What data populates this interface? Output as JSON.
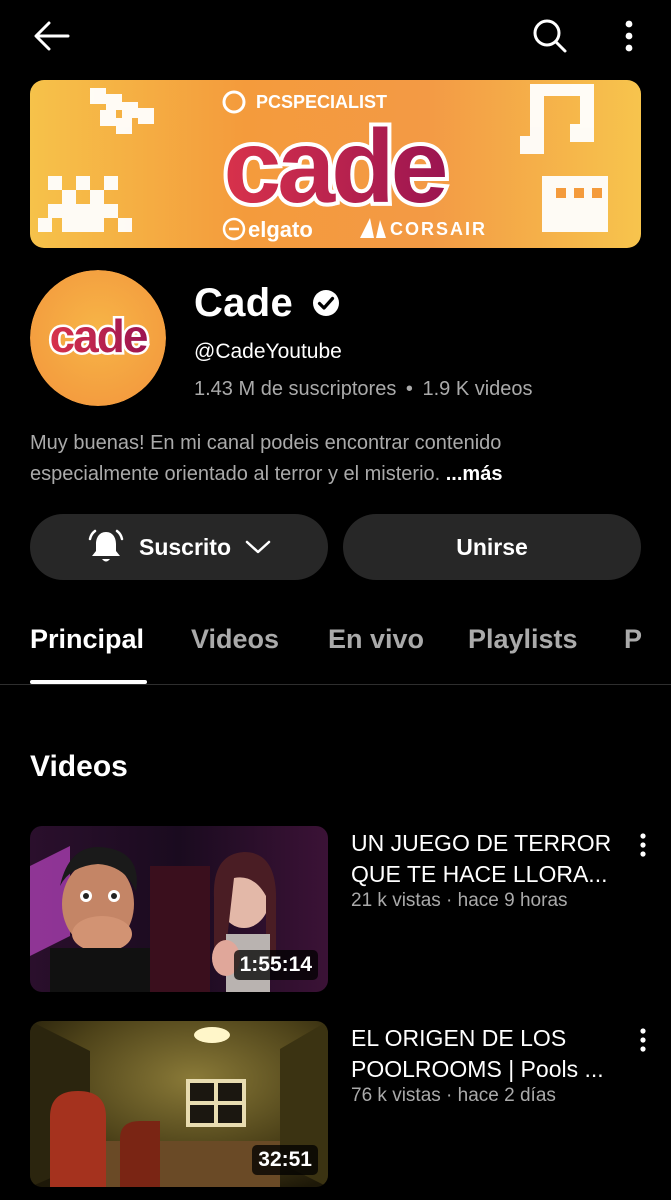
{
  "topbar": {
    "back_icon": "arrow-left-icon",
    "search_icon": "search-icon",
    "more_icon": "more-vert-icon"
  },
  "banner": {
    "brand_main": "cade",
    "sponsor_top": "PCSPECIALIST",
    "sponsor_left": "elgato",
    "sponsor_right": "CORSAIR"
  },
  "avatar": {
    "text": "cade"
  },
  "channel": {
    "name": "Cade",
    "verified_icon": "verified-check-icon",
    "handle": "@CadeYoutube",
    "subscribers": "1.43 M de suscriptores",
    "separator": "•",
    "videos_count": "1.9 K videos",
    "description_line1": "Muy buenas! En mi canal podeis encontrar contenido",
    "description_line2": "especialmente orientado al terror y el misterio.",
    "more_label": "...más"
  },
  "actions": {
    "subscribed_label": "Suscrito",
    "bell_icon": "bell-icon",
    "chevron_icon": "chevron-down-icon",
    "join_label": "Unirse"
  },
  "tabs": [
    {
      "label": "Principal",
      "active": true
    },
    {
      "label": "Videos",
      "active": false
    },
    {
      "label": "En vivo",
      "active": false
    },
    {
      "label": "Playlists",
      "active": false
    },
    {
      "label": "P",
      "active": false
    }
  ],
  "section": {
    "title": "Videos"
  },
  "videos": [
    {
      "title_line1": "UN JUEGO DE TERROR",
      "title_line2": "QUE TE HACE LLORA...",
      "views": "21 k vistas",
      "age": "hace 9 horas",
      "duration": "1:55:14"
    },
    {
      "title_line1": "EL ORIGEN DE LOS",
      "title_line2": "POOLROOMS | Pools ...",
      "views": "76 k vistas",
      "age": "hace 2 días",
      "duration": "32:51"
    }
  ],
  "colors": {
    "background": "#000000",
    "secondary_text": "#aaaaaa",
    "pill_bg": "#272727",
    "banner_orange": "#f3a23b",
    "banner_magenta": "#c2185b"
  }
}
